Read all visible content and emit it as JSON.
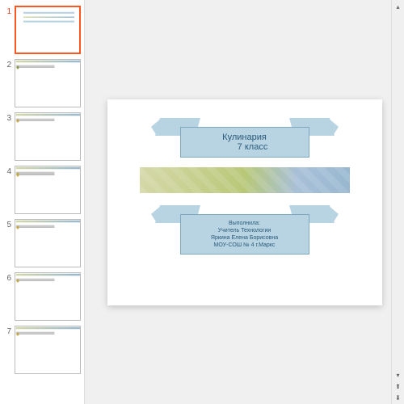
{
  "slides": [
    {
      "num": "1",
      "active": true
    },
    {
      "num": "2",
      "active": false
    },
    {
      "num": "3",
      "active": false
    },
    {
      "num": "4",
      "active": false
    },
    {
      "num": "5",
      "active": false
    },
    {
      "num": "6",
      "active": false
    },
    {
      "num": "7",
      "active": false
    }
  ],
  "title": {
    "line1": "Кулинария",
    "line2": "7 класс"
  },
  "author": {
    "line1": "Выполнила:",
    "line2": "Учитель Технологии",
    "line3": "Яркина Елена Борисовна",
    "line4": "МОУ-СОШ № 4 г.Маркс"
  }
}
